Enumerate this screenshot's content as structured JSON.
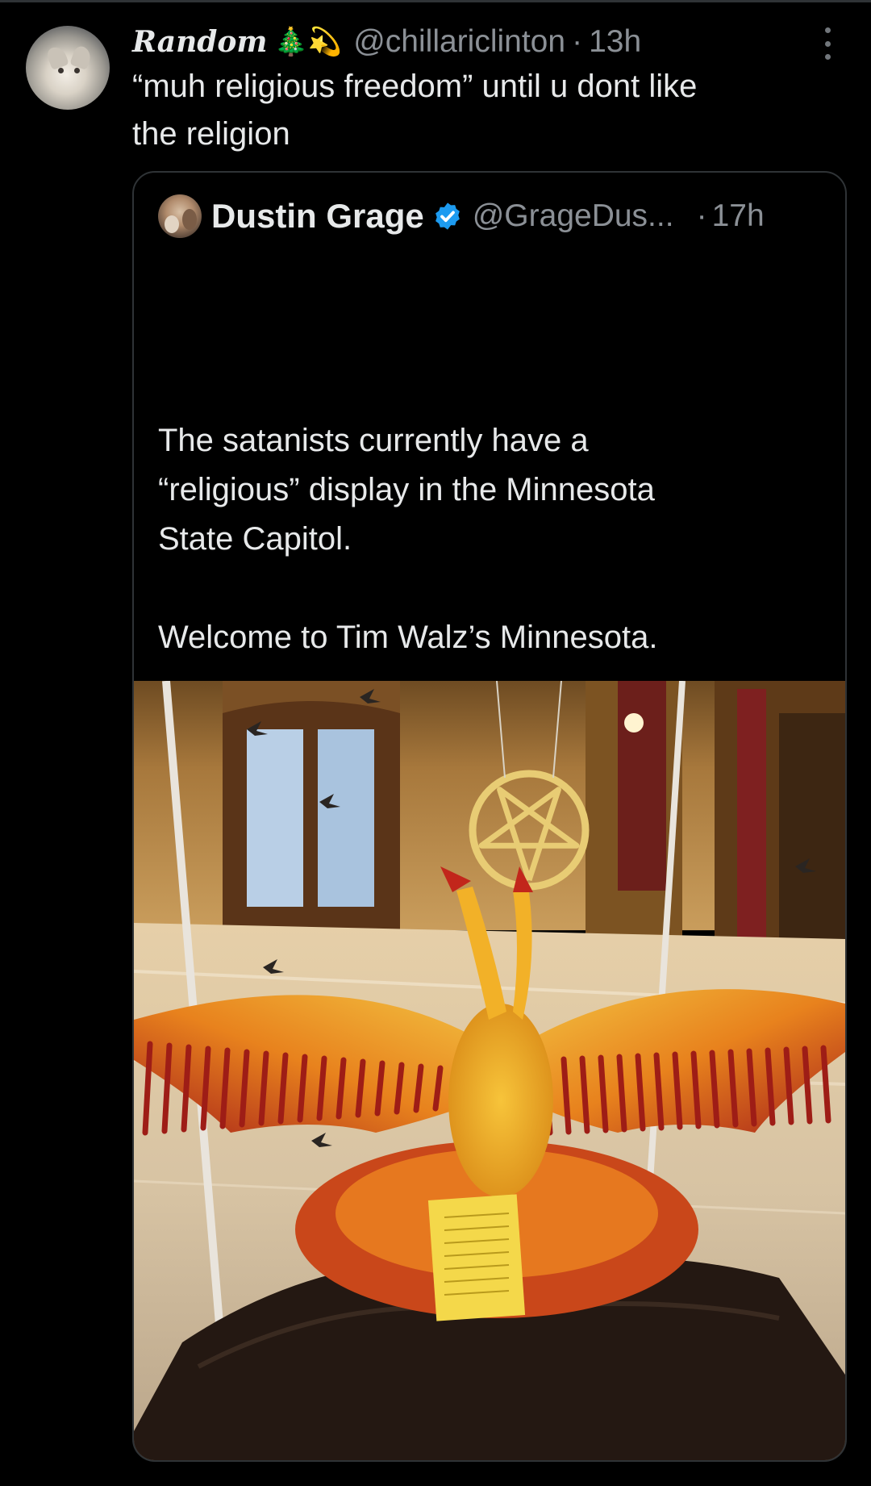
{
  "tweet": {
    "author": {
      "display_name": "Random",
      "emojis": "🎄💫",
      "handle": "@chillariclinton",
      "separator": "·",
      "time": "13h",
      "avatar_icon": "cat-avatar"
    },
    "text_line_1": "“muh religious freedom” until u dont like",
    "text_line_2": "the religion",
    "more_icon": "more-dots-icon"
  },
  "quote": {
    "author": {
      "display_name": "Dustin Grage",
      "verified_icon": "verified-badge-icon",
      "verified_color": "#1d9bf0",
      "handle": "@GrageDus...",
      "separator": "·",
      "time": "17h"
    },
    "text_lines": [
      "The satanists currently have a",
      "“religious” display in the Minnesota",
      "State Capitol.",
      "",
      "Welcome to Tim Walz’s Minnesota."
    ],
    "media": {
      "kind": "photo",
      "sign_icon": "pentagram-icon"
    }
  },
  "colors": {
    "background": "#000000",
    "text_primary": "#e7e9ea",
    "text_secondary": "#8b9096",
    "border": "#2f3336"
  }
}
